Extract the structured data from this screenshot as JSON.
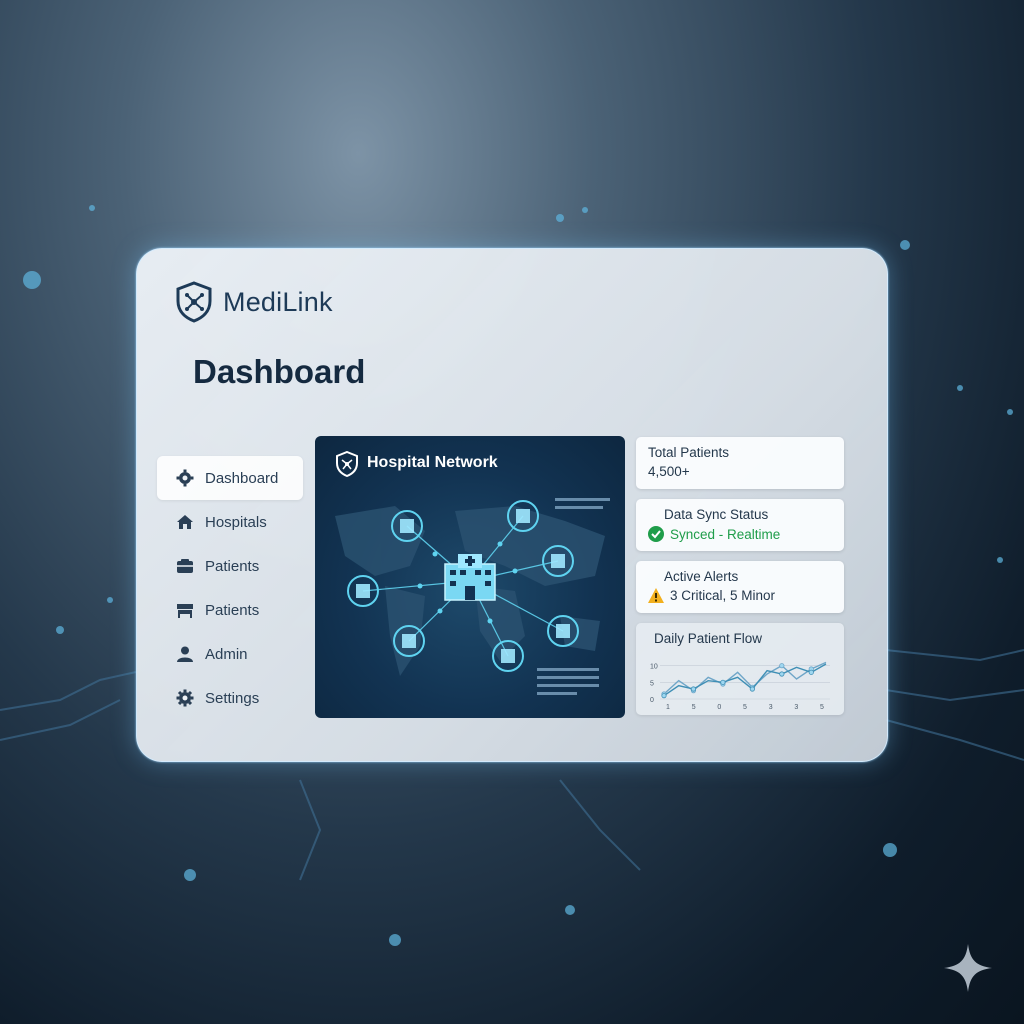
{
  "app": {
    "name": "MediLink"
  },
  "page": {
    "title": "Dashboard"
  },
  "sidebar": {
    "items": [
      {
        "label": "Dashboard",
        "icon": "gear-icon",
        "active": true
      },
      {
        "label": "Hospitals",
        "icon": "home-icon"
      },
      {
        "label": "Patients",
        "icon": "folder-icon"
      },
      {
        "label": "Patients",
        "icon": "bed-icon"
      },
      {
        "label": "Admin",
        "icon": "user-icon"
      },
      {
        "label": "Settings",
        "icon": "gear-icon"
      }
    ]
  },
  "network": {
    "title": "Hospital Network",
    "icons": [
      "shield-icon",
      "hospital-icon",
      "node-icon"
    ]
  },
  "cards": {
    "total_patients": {
      "title": "Total Patients",
      "value": "4,500+"
    },
    "sync": {
      "title": "Data Sync Status",
      "value": "Synced - Realtime",
      "icon": "check-circle-icon"
    },
    "alerts": {
      "title": "Active Alerts",
      "value": "3 Critical, 5 Minor",
      "icon": "warning-icon"
    }
  },
  "chart_data": {
    "type": "line",
    "title": "Daily Patient Flow",
    "x": [
      "1",
      "5",
      "0",
      "5",
      "3",
      "3",
      "5"
    ],
    "yticks": [
      "10",
      "5",
      "0"
    ],
    "series": [
      {
        "values": [
          1.5,
          5.5,
          2.5,
          6.5,
          4.5,
          8.0,
          3.5,
          7.5,
          10.0,
          6.0,
          9.0,
          11.0
        ]
      },
      {
        "values": [
          1.0,
          4.0,
          3.0,
          5.5,
          5.0,
          6.5,
          3.0,
          8.5,
          7.5,
          9.5,
          8.0,
          10.5
        ]
      }
    ],
    "ylim": [
      0,
      12
    ]
  },
  "colors": {
    "accent": "#1d3a57",
    "success": "#1f9d4a",
    "warning": "#f2b01e",
    "network_bg": "#123352",
    "network_line": "#5fd3f0"
  }
}
